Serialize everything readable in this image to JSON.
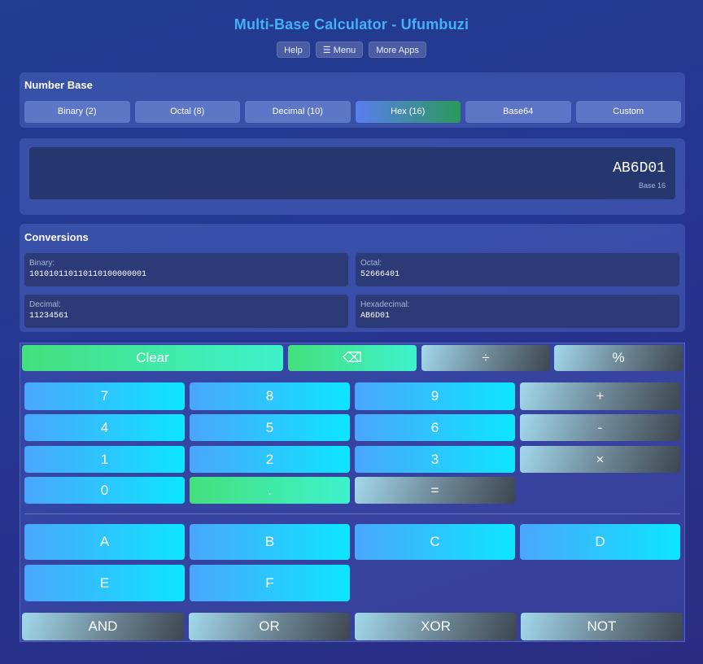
{
  "app": {
    "title": "Multi-Base Calculator - Ufumbuzi"
  },
  "nav": {
    "help": "Help",
    "menu": "☰ Menu",
    "more_apps": "More Apps"
  },
  "number_base": {
    "title": "Number Base",
    "options": [
      "Binary (2)",
      "Octal (8)",
      "Decimal (10)",
      "Hex (16)",
      "Base64",
      "Custom"
    ],
    "selected": "Hex (16)"
  },
  "display": {
    "value": "AB6D01",
    "base_label": "Base 16"
  },
  "conversions": {
    "title": "Conversions",
    "binary": {
      "label": "Binary:",
      "value": "101010110110110100000001"
    },
    "octal": {
      "label": "Octal:",
      "value": "52666401"
    },
    "decimal": {
      "label": "Decimal:",
      "value": "11234561"
    },
    "hex": {
      "label": "Hexadecimal:",
      "value": "AB6D01"
    }
  },
  "keypad": {
    "clear": "Clear",
    "backspace": "⌫",
    "divide": "÷",
    "percent": "%",
    "digits": [
      "7",
      "8",
      "9",
      "4",
      "5",
      "6",
      "1",
      "2",
      "3",
      "0"
    ],
    "dot": ".",
    "equals": "=",
    "plus": "+",
    "minus": "-",
    "multiply": "×",
    "hex_digits": [
      "A",
      "B",
      "C",
      "D",
      "E",
      "F"
    ],
    "logic": [
      "AND",
      "OR",
      "XOR",
      "NOT"
    ]
  },
  "colors": {
    "title_accent": "#43b0f7",
    "active_base_start": "#5a7df0",
    "active_base_end": "#2a9a5a",
    "number_key_start": "#4aa6fd",
    "number_key_end": "#0de6fd",
    "green_key_start": "#44e07e",
    "green_key_end": "#3df2cc"
  }
}
